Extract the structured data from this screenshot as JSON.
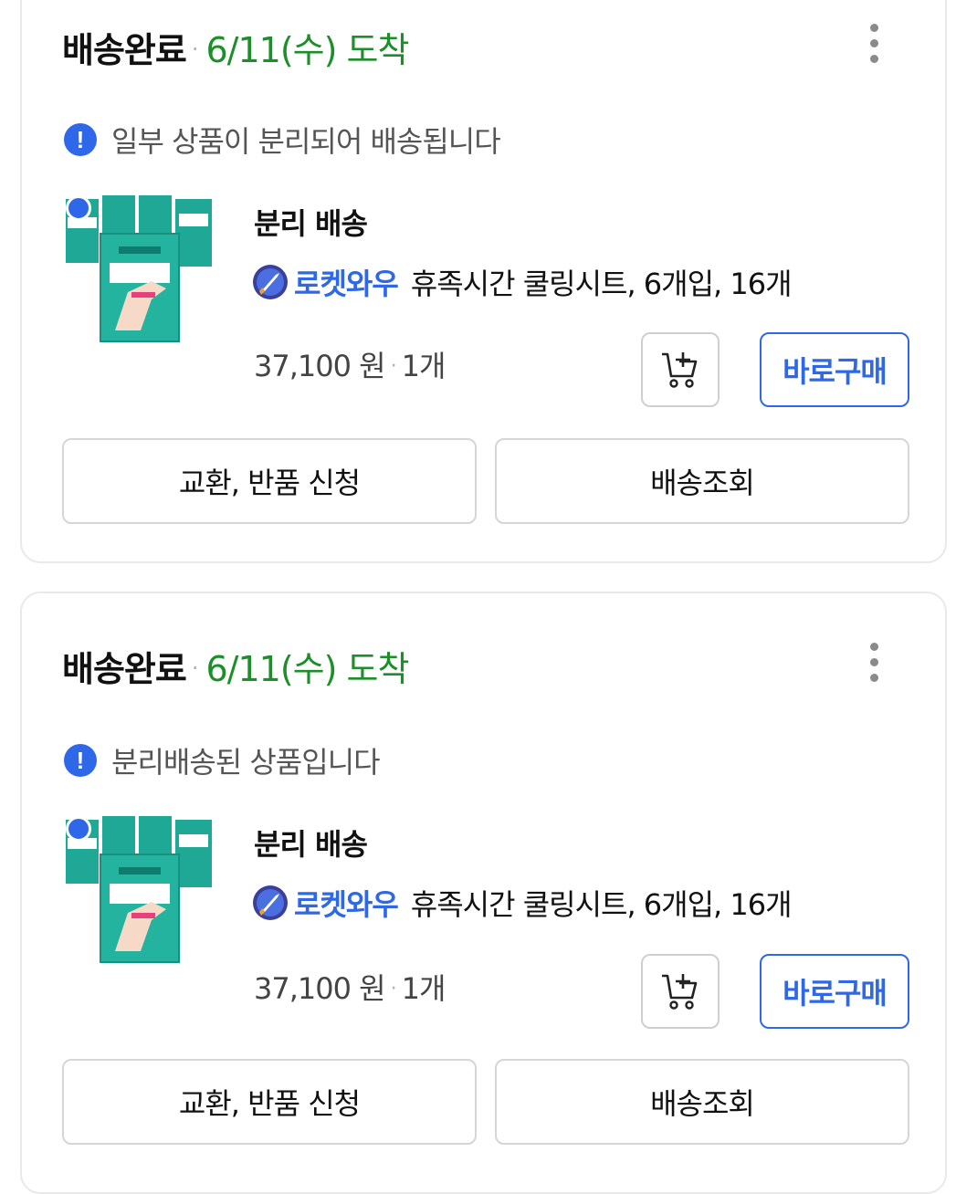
{
  "orders": [
    {
      "status": "배송완료",
      "separator": "·",
      "arrival": "6/11(수) 도착",
      "notice": "일부 상품이 분리되어 배송됩니다",
      "delivery_type": "분리 배송",
      "badge": "로켓와우",
      "product_name": "휴족시간 쿨링시트, 6개입, 16개",
      "price": "37,100 원",
      "quantity": "1개",
      "buy_label": "바로구매",
      "exchange_label": "교환, 반품 신청",
      "track_label": "배송조회"
    },
    {
      "status": "배송완료",
      "separator": "·",
      "arrival": "6/11(수) 도착",
      "notice": "분리배송된 상품입니다",
      "delivery_type": "분리 배송",
      "badge": "로켓와우",
      "product_name": "휴족시간 쿨링시트, 6개입, 16개",
      "price": "37,100 원",
      "quantity": "1개",
      "buy_label": "바로구매",
      "exchange_label": "교환, 반품 신청",
      "track_label": "배송조회"
    }
  ],
  "colors": {
    "accent": "#2e68e8",
    "arrival_green": "#1c8f2a",
    "product_teal": "#1fa896"
  },
  "icons": [
    "more-vertical-icon",
    "alert-icon",
    "rocket-icon",
    "add-to-cart-icon"
  ]
}
